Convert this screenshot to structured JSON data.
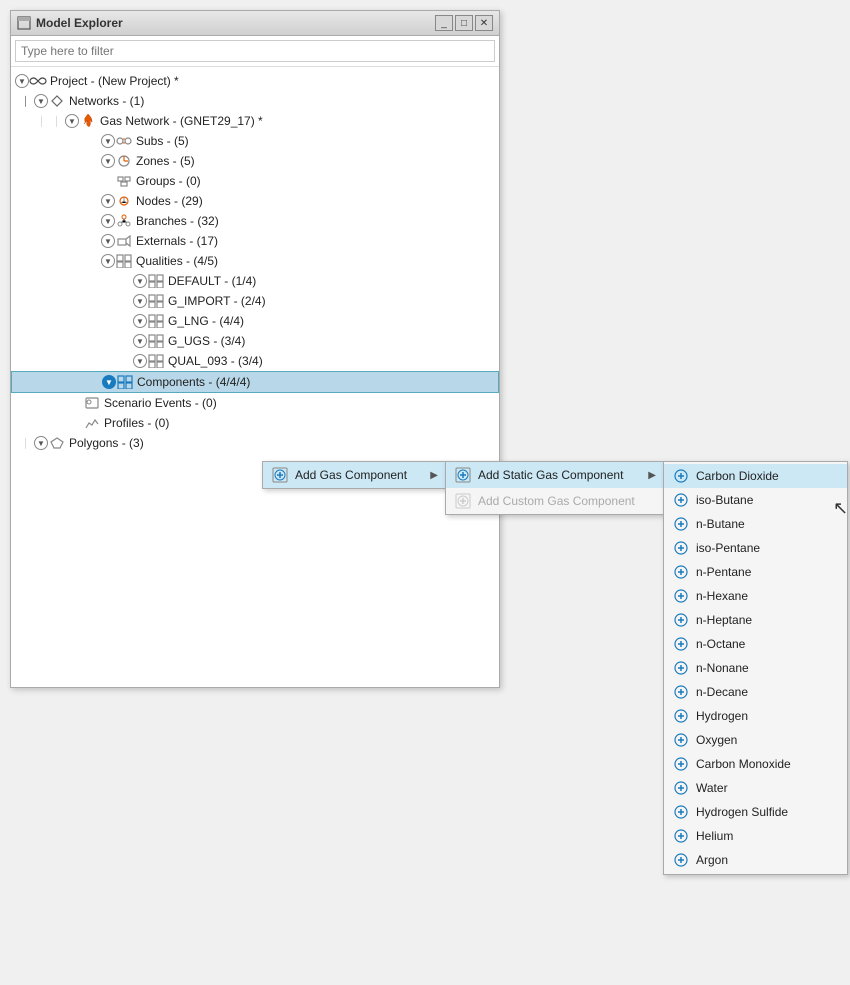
{
  "window": {
    "title": "Model Explorer",
    "filter_placeholder": "Type here to filter"
  },
  "title_buttons": {
    "minimize": "_",
    "restore": "□",
    "close": "✕"
  },
  "tree": {
    "items": [
      {
        "id": "project",
        "indent": 0,
        "expand": "down",
        "label": "Project - (New Project) *",
        "icon": "infinity",
        "level": 1
      },
      {
        "id": "networks",
        "indent": 1,
        "expand": "down",
        "label": "Networks - (1)",
        "icon": "networks",
        "level": 2
      },
      {
        "id": "gasnetwork",
        "indent": 2,
        "expand": "down",
        "label": "Gas Network - (GNET29_17) *",
        "icon": "gas-flame",
        "level": 3
      },
      {
        "id": "subs",
        "indent": 3,
        "expand": "down",
        "label": "Subs - (5)",
        "icon": "subs",
        "level": 4
      },
      {
        "id": "zones",
        "indent": 3,
        "expand": "down",
        "label": "Zones - (5)",
        "icon": "zones",
        "level": 4
      },
      {
        "id": "groups",
        "indent": 3,
        "expand": "none",
        "label": "Groups - (0)",
        "icon": "groups",
        "level": 4
      },
      {
        "id": "nodes",
        "indent": 3,
        "expand": "down",
        "label": "Nodes - (29)",
        "icon": "nodes",
        "level": 4
      },
      {
        "id": "branches",
        "indent": 3,
        "expand": "down",
        "label": "Branches - (32)",
        "icon": "branches",
        "level": 4
      },
      {
        "id": "externals",
        "indent": 3,
        "expand": "down",
        "label": "Externals - (17)",
        "icon": "externals",
        "level": 4
      },
      {
        "id": "qualities",
        "indent": 3,
        "expand": "down",
        "label": "Qualities - (4/5)",
        "icon": "qualities",
        "level": 4
      },
      {
        "id": "default",
        "indent": 4,
        "expand": "down",
        "label": "DEFAULT - (1/4)",
        "icon": "quality-item",
        "level": 5
      },
      {
        "id": "gimport",
        "indent": 4,
        "expand": "down",
        "label": "G_IMPORT - (2/4)",
        "icon": "quality-item",
        "level": 5
      },
      {
        "id": "glng",
        "indent": 4,
        "expand": "down",
        "label": "G_LNG - (4/4)",
        "icon": "quality-item",
        "level": 5
      },
      {
        "id": "gugs",
        "indent": 4,
        "expand": "down",
        "label": "G_UGS - (3/4)",
        "icon": "quality-item",
        "level": 5
      },
      {
        "id": "qual093",
        "indent": 4,
        "expand": "down",
        "label": "QUAL_093 - (3/4)",
        "icon": "quality-item",
        "level": 5
      },
      {
        "id": "components",
        "indent": 3,
        "expand": "down-blue",
        "label": "Components - (4/4/4)",
        "icon": "components",
        "level": 4,
        "selected": true
      },
      {
        "id": "scenarioevents",
        "indent": 2,
        "expand": "none",
        "label": "Scenario Events - (0)",
        "icon": "scenario",
        "level": 3
      },
      {
        "id": "profiles",
        "indent": 2,
        "expand": "none",
        "label": "Profiles - (0)",
        "icon": "profiles",
        "level": 3
      },
      {
        "id": "polygons",
        "indent": 1,
        "expand": "down",
        "label": "Polygons - (3)",
        "icon": "polygons",
        "level": 2
      }
    ]
  },
  "context_menu_l1": {
    "items": [
      {
        "id": "add-gas-component",
        "label": "Add Gas Component",
        "has_arrow": true,
        "icon": "add-icon",
        "disabled": false
      }
    ]
  },
  "context_menu_l2": {
    "items": [
      {
        "id": "add-static",
        "label": "Add Static Gas Component",
        "has_arrow": true,
        "icon": "add-icon",
        "disabled": false
      },
      {
        "id": "add-custom",
        "label": "Add Custom Gas Component",
        "has_arrow": false,
        "icon": "add-icon",
        "disabled": true
      }
    ]
  },
  "context_menu_l3": {
    "items": [
      {
        "id": "carbon-dioxide",
        "label": "Carbon Dioxide",
        "highlighted": true
      },
      {
        "id": "iso-butane",
        "label": "iso-Butane"
      },
      {
        "id": "n-butane",
        "label": "n-Butane"
      },
      {
        "id": "iso-pentane",
        "label": "iso-Pentane"
      },
      {
        "id": "n-pentane",
        "label": "n-Pentane"
      },
      {
        "id": "n-hexane",
        "label": "n-Hexane"
      },
      {
        "id": "n-heptane",
        "label": "n-Heptane"
      },
      {
        "id": "n-octane",
        "label": "n-Octane"
      },
      {
        "id": "n-nonane",
        "label": "n-Nonane"
      },
      {
        "id": "n-decane",
        "label": "n-Decane"
      },
      {
        "id": "hydrogen",
        "label": "Hydrogen"
      },
      {
        "id": "oxygen",
        "label": "Oxygen"
      },
      {
        "id": "carbon-monoxide",
        "label": "Carbon Monoxide"
      },
      {
        "id": "water",
        "label": "Water"
      },
      {
        "id": "hydrogen-sulfide",
        "label": "Hydrogen Sulfide"
      },
      {
        "id": "helium",
        "label": "Helium"
      },
      {
        "id": "argon",
        "label": "Argon"
      }
    ]
  }
}
